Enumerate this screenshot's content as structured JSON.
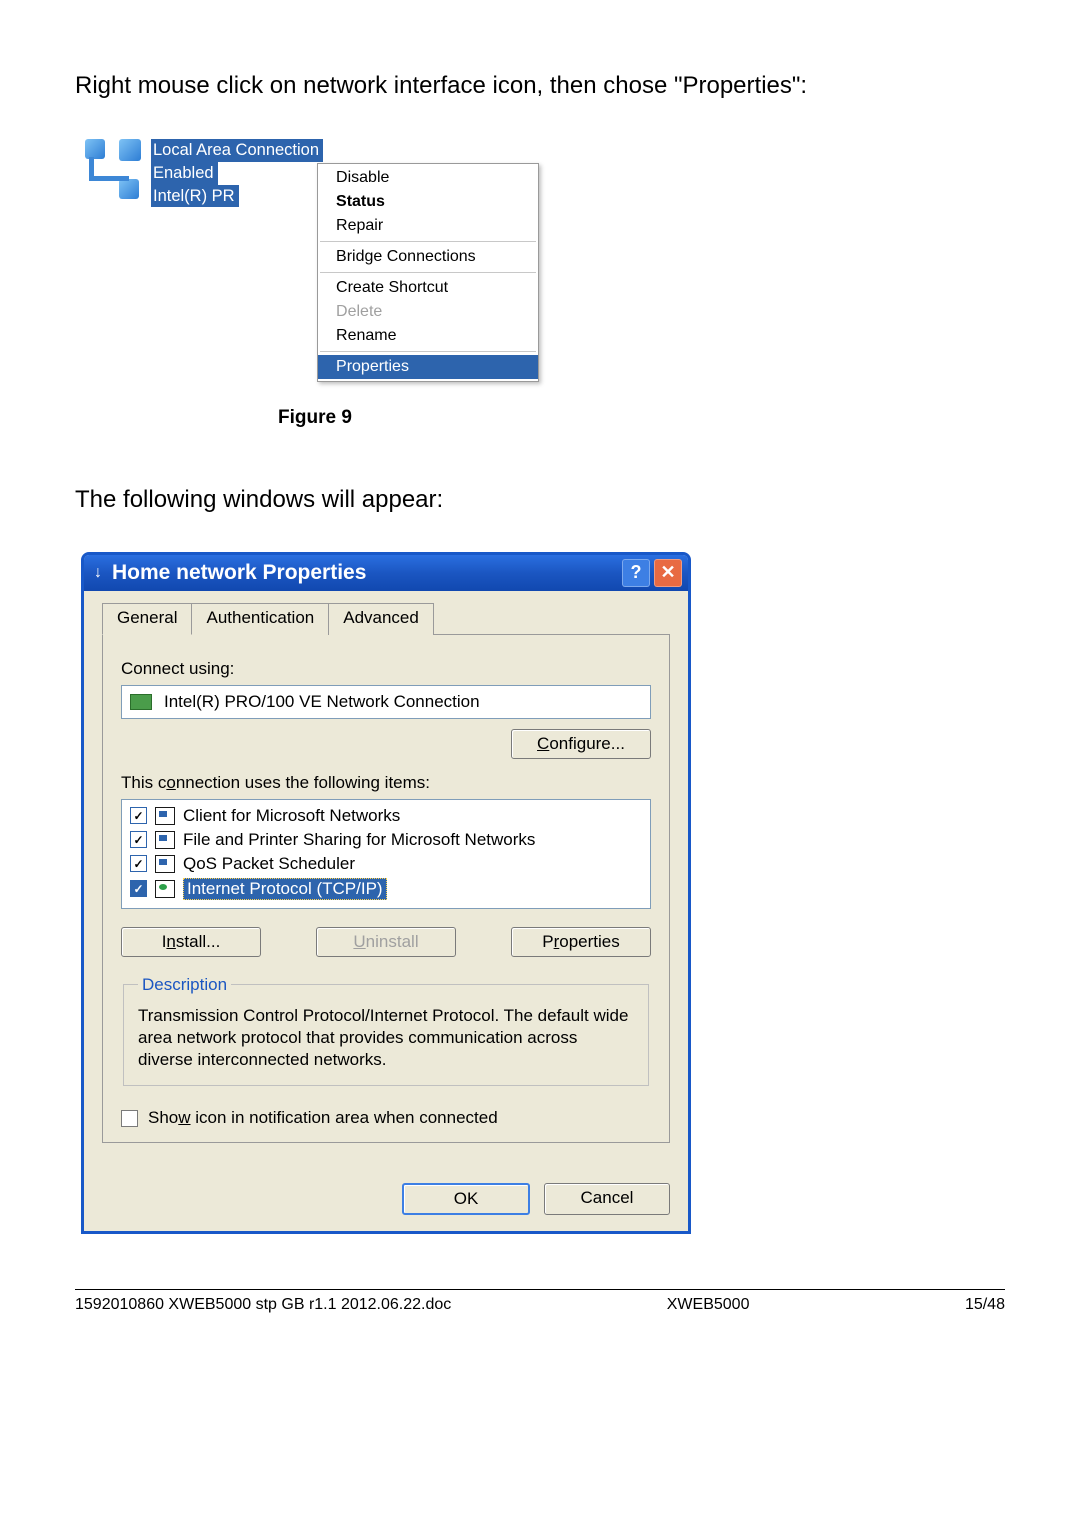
{
  "body": {
    "intro_line": "Right mouse click on network interface icon, then chose \"Properties\":",
    "second_line": "The following windows will appear:"
  },
  "fig9": {
    "conn_labels": [
      "Local Area Connection",
      "Enabled",
      "Intel(R) PR"
    ],
    "menu": {
      "disable": "Disable",
      "status": "Status",
      "repair": "Repair",
      "bridge": "Bridge Connections",
      "shortcut": "Create Shortcut",
      "delete": "Delete",
      "rename": "Rename",
      "properties": "Properties"
    },
    "caption": "Figure 9"
  },
  "dialog": {
    "title": "Home network Properties",
    "tabs": {
      "general": "General",
      "auth": "Authentication",
      "adv": "Advanced"
    },
    "connect_using_label": "Connect using:",
    "adapter": "Intel(R) PRO/100 VE Network Connection",
    "configure_btn": "Configure...",
    "items_label": "This connection uses the following items:",
    "items": {
      "client": "Client for Microsoft Networks",
      "fps": "File and Printer Sharing for Microsoft Networks",
      "qos": "QoS Packet Scheduler",
      "tcpip": "Internet Protocol (TCP/IP)"
    },
    "install_btn": "Install...",
    "uninstall_btn": "Uninstall",
    "properties_btn": "Properties",
    "desc_legend": "Description",
    "desc_text": "Transmission Control Protocol/Internet Protocol. The default wide area network protocol that provides communication across diverse interconnected networks.",
    "showicon": "Show icon in notification area when connected",
    "ok": "OK",
    "cancel": "Cancel"
  },
  "footer": {
    "left": "1592010860 XWEB5000 stp GB r1.1 2012.06.22.doc",
    "center": "XWEB5000",
    "right": "15/48"
  }
}
